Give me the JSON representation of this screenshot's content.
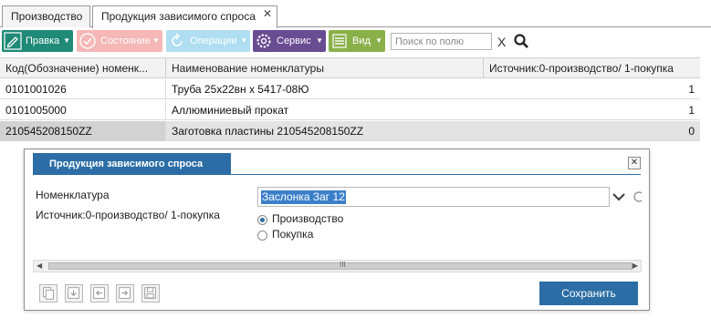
{
  "tabs": [
    {
      "label": "Производство",
      "active": false
    },
    {
      "label": "Продукция зависимого спроса",
      "active": true,
      "close_glyph": "✕"
    }
  ],
  "toolbar": {
    "buttons": [
      {
        "label": "Правка",
        "icon": "pencil-icon",
        "color": "#1f8a77",
        "enabled": true
      },
      {
        "label": "Состояние",
        "icon": "check-circle-icon",
        "color": "#f07e7e",
        "enabled": false
      },
      {
        "label": "Операции",
        "icon": "refresh-icon",
        "color": "#6ec3e6",
        "enabled": false
      },
      {
        "label": "Сервис",
        "icon": "gear-icon",
        "color": "#6a4c93",
        "enabled": true
      },
      {
        "label": "Вид",
        "icon": "list-icon",
        "color": "#8ab04a",
        "enabled": true
      }
    ],
    "search_placeholder": "Поиск по полю",
    "clear_glyph": "X"
  },
  "grid": {
    "columns": [
      "Код(Обозначение) номенк...",
      "Наименование номенклатуры",
      "Источник:0-производство/ 1-покупка"
    ],
    "rows": [
      {
        "code": "0101001026",
        "name": "Труба 25х22вн х 5417-08Ю",
        "source": "1",
        "selected": false
      },
      {
        "code": "0101005000",
        "name": "Аллюминиевый прокат",
        "source": "1",
        "selected": false
      },
      {
        "code": "210545208150ZZ",
        "name": "Заготовка пластины 210545208150ZZ",
        "source": "0",
        "selected": true
      }
    ]
  },
  "dialog": {
    "title": "Продукция зависимого спроса",
    "close_glyph": "✕",
    "nomenclature_label": "Номенклатура",
    "nomenclature_value": "Заслонка Заг 12",
    "source_label": "Источник:0-производство/ 1-покупка",
    "radio_options": [
      {
        "label": "Производство",
        "checked": true
      },
      {
        "label": "Покупка",
        "checked": false
      }
    ],
    "scroll_grip": "III",
    "save_label": "Сохранить"
  },
  "colors": {
    "accent": "#2b6da4",
    "selection": "#3c7fc9"
  }
}
